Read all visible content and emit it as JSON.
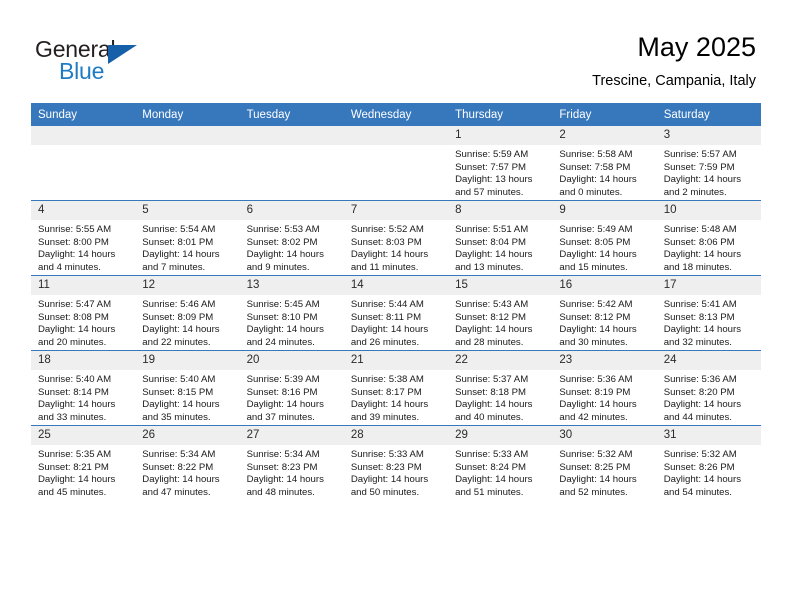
{
  "brand": {
    "word_one": "General",
    "word_two": "Blue",
    "triangle_icon": "blue-triangle-icon"
  },
  "header": {
    "title": "May 2025",
    "subtitle": "Trescine, Campania, Italy",
    "accent_color": "#3777bc",
    "daynum_band_color": "#efefef"
  },
  "calendar": {
    "weekday_headers": [
      "Sunday",
      "Monday",
      "Tuesday",
      "Wednesday",
      "Thursday",
      "Friday",
      "Saturday"
    ],
    "labels": {
      "sunrise": "Sunrise:",
      "sunset": "Sunset:",
      "daylight": "Daylight:"
    },
    "weeks": [
      [
        {
          "day": "",
          "empty": true
        },
        {
          "day": "",
          "empty": true
        },
        {
          "day": "",
          "empty": true
        },
        {
          "day": "",
          "empty": true
        },
        {
          "day": "1",
          "sunrise": "Sunrise: 5:59 AM",
          "sunset": "Sunset: 7:57 PM",
          "daylight_1": "Daylight: 13 hours",
          "daylight_2": "and 57 minutes."
        },
        {
          "day": "2",
          "sunrise": "Sunrise: 5:58 AM",
          "sunset": "Sunset: 7:58 PM",
          "daylight_1": "Daylight: 14 hours",
          "daylight_2": "and 0 minutes."
        },
        {
          "day": "3",
          "sunrise": "Sunrise: 5:57 AM",
          "sunset": "Sunset: 7:59 PM",
          "daylight_1": "Daylight: 14 hours",
          "daylight_2": "and 2 minutes."
        }
      ],
      [
        {
          "day": "4",
          "sunrise": "Sunrise: 5:55 AM",
          "sunset": "Sunset: 8:00 PM",
          "daylight_1": "Daylight: 14 hours",
          "daylight_2": "and 4 minutes."
        },
        {
          "day": "5",
          "sunrise": "Sunrise: 5:54 AM",
          "sunset": "Sunset: 8:01 PM",
          "daylight_1": "Daylight: 14 hours",
          "daylight_2": "and 7 minutes."
        },
        {
          "day": "6",
          "sunrise": "Sunrise: 5:53 AM",
          "sunset": "Sunset: 8:02 PM",
          "daylight_1": "Daylight: 14 hours",
          "daylight_2": "and 9 minutes."
        },
        {
          "day": "7",
          "sunrise": "Sunrise: 5:52 AM",
          "sunset": "Sunset: 8:03 PM",
          "daylight_1": "Daylight: 14 hours",
          "daylight_2": "and 11 minutes."
        },
        {
          "day": "8",
          "sunrise": "Sunrise: 5:51 AM",
          "sunset": "Sunset: 8:04 PM",
          "daylight_1": "Daylight: 14 hours",
          "daylight_2": "and 13 minutes."
        },
        {
          "day": "9",
          "sunrise": "Sunrise: 5:49 AM",
          "sunset": "Sunset: 8:05 PM",
          "daylight_1": "Daylight: 14 hours",
          "daylight_2": "and 15 minutes."
        },
        {
          "day": "10",
          "sunrise": "Sunrise: 5:48 AM",
          "sunset": "Sunset: 8:06 PM",
          "daylight_1": "Daylight: 14 hours",
          "daylight_2": "and 18 minutes."
        }
      ],
      [
        {
          "day": "11",
          "sunrise": "Sunrise: 5:47 AM",
          "sunset": "Sunset: 8:08 PM",
          "daylight_1": "Daylight: 14 hours",
          "daylight_2": "and 20 minutes."
        },
        {
          "day": "12",
          "sunrise": "Sunrise: 5:46 AM",
          "sunset": "Sunset: 8:09 PM",
          "daylight_1": "Daylight: 14 hours",
          "daylight_2": "and 22 minutes."
        },
        {
          "day": "13",
          "sunrise": "Sunrise: 5:45 AM",
          "sunset": "Sunset: 8:10 PM",
          "daylight_1": "Daylight: 14 hours",
          "daylight_2": "and 24 minutes."
        },
        {
          "day": "14",
          "sunrise": "Sunrise: 5:44 AM",
          "sunset": "Sunset: 8:11 PM",
          "daylight_1": "Daylight: 14 hours",
          "daylight_2": "and 26 minutes."
        },
        {
          "day": "15",
          "sunrise": "Sunrise: 5:43 AM",
          "sunset": "Sunset: 8:12 PM",
          "daylight_1": "Daylight: 14 hours",
          "daylight_2": "and 28 minutes."
        },
        {
          "day": "16",
          "sunrise": "Sunrise: 5:42 AM",
          "sunset": "Sunset: 8:12 PM",
          "daylight_1": "Daylight: 14 hours",
          "daylight_2": "and 30 minutes."
        },
        {
          "day": "17",
          "sunrise": "Sunrise: 5:41 AM",
          "sunset": "Sunset: 8:13 PM",
          "daylight_1": "Daylight: 14 hours",
          "daylight_2": "and 32 minutes."
        }
      ],
      [
        {
          "day": "18",
          "sunrise": "Sunrise: 5:40 AM",
          "sunset": "Sunset: 8:14 PM",
          "daylight_1": "Daylight: 14 hours",
          "daylight_2": "and 33 minutes."
        },
        {
          "day": "19",
          "sunrise": "Sunrise: 5:40 AM",
          "sunset": "Sunset: 8:15 PM",
          "daylight_1": "Daylight: 14 hours",
          "daylight_2": "and 35 minutes."
        },
        {
          "day": "20",
          "sunrise": "Sunrise: 5:39 AM",
          "sunset": "Sunset: 8:16 PM",
          "daylight_1": "Daylight: 14 hours",
          "daylight_2": "and 37 minutes."
        },
        {
          "day": "21",
          "sunrise": "Sunrise: 5:38 AM",
          "sunset": "Sunset: 8:17 PM",
          "daylight_1": "Daylight: 14 hours",
          "daylight_2": "and 39 minutes."
        },
        {
          "day": "22",
          "sunrise": "Sunrise: 5:37 AM",
          "sunset": "Sunset: 8:18 PM",
          "daylight_1": "Daylight: 14 hours",
          "daylight_2": "and 40 minutes."
        },
        {
          "day": "23",
          "sunrise": "Sunrise: 5:36 AM",
          "sunset": "Sunset: 8:19 PM",
          "daylight_1": "Daylight: 14 hours",
          "daylight_2": "and 42 minutes."
        },
        {
          "day": "24",
          "sunrise": "Sunrise: 5:36 AM",
          "sunset": "Sunset: 8:20 PM",
          "daylight_1": "Daylight: 14 hours",
          "daylight_2": "and 44 minutes."
        }
      ],
      [
        {
          "day": "25",
          "sunrise": "Sunrise: 5:35 AM",
          "sunset": "Sunset: 8:21 PM",
          "daylight_1": "Daylight: 14 hours",
          "daylight_2": "and 45 minutes."
        },
        {
          "day": "26",
          "sunrise": "Sunrise: 5:34 AM",
          "sunset": "Sunset: 8:22 PM",
          "daylight_1": "Daylight: 14 hours",
          "daylight_2": "and 47 minutes."
        },
        {
          "day": "27",
          "sunrise": "Sunrise: 5:34 AM",
          "sunset": "Sunset: 8:23 PM",
          "daylight_1": "Daylight: 14 hours",
          "daylight_2": "and 48 minutes."
        },
        {
          "day": "28",
          "sunrise": "Sunrise: 5:33 AM",
          "sunset": "Sunset: 8:23 PM",
          "daylight_1": "Daylight: 14 hours",
          "daylight_2": "and 50 minutes."
        },
        {
          "day": "29",
          "sunrise": "Sunrise: 5:33 AM",
          "sunset": "Sunset: 8:24 PM",
          "daylight_1": "Daylight: 14 hours",
          "daylight_2": "and 51 minutes."
        },
        {
          "day": "30",
          "sunrise": "Sunrise: 5:32 AM",
          "sunset": "Sunset: 8:25 PM",
          "daylight_1": "Daylight: 14 hours",
          "daylight_2": "and 52 minutes."
        },
        {
          "day": "31",
          "sunrise": "Sunrise: 5:32 AM",
          "sunset": "Sunset: 8:26 PM",
          "daylight_1": "Daylight: 14 hours",
          "daylight_2": "and 54 minutes."
        }
      ]
    ]
  }
}
